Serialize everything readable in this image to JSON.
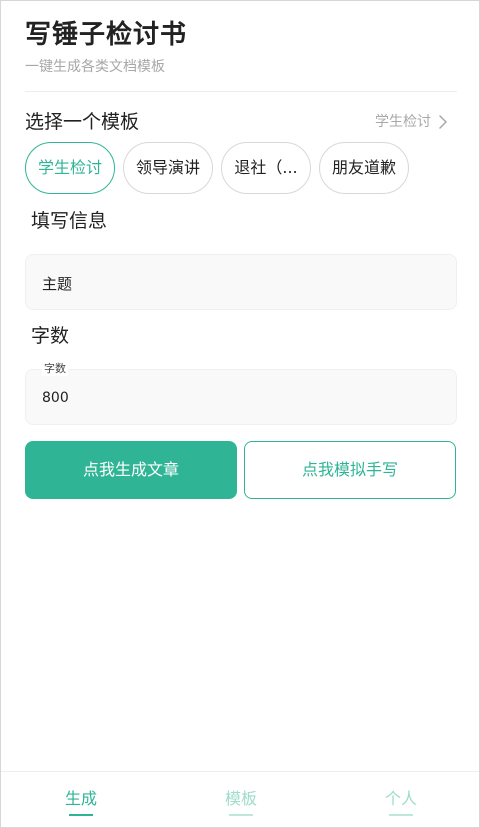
{
  "header": {
    "title": "写锤子检讨书",
    "subtitle": "一键生成各类文档模板"
  },
  "template_section": {
    "title": "选择一个模板",
    "selected": "学生检讨",
    "chips": [
      {
        "label": "学生检讨",
        "active": true
      },
      {
        "label": "领导演讲",
        "active": false
      },
      {
        "label": "退社（...",
        "active": false
      },
      {
        "label": "朋友道歉",
        "active": false
      }
    ]
  },
  "info_section": {
    "title": "填写信息",
    "topic_placeholder": "主题"
  },
  "count_section": {
    "title": "字数",
    "field_label": "字数",
    "value": "800"
  },
  "actions": {
    "generate_label": "点我生成文章",
    "handwrite_label": "点我模拟手写"
  },
  "bottom_nav": {
    "items": [
      {
        "label": "生成",
        "active": true
      },
      {
        "label": "模板",
        "active": false
      },
      {
        "label": "个人",
        "active": false
      }
    ]
  },
  "colors": {
    "accent": "#2fb596",
    "accent_light": "#9fdccb",
    "muted_text": "#a8a8a8"
  },
  "icons": {
    "selected_link": "chevron-right-icon"
  }
}
